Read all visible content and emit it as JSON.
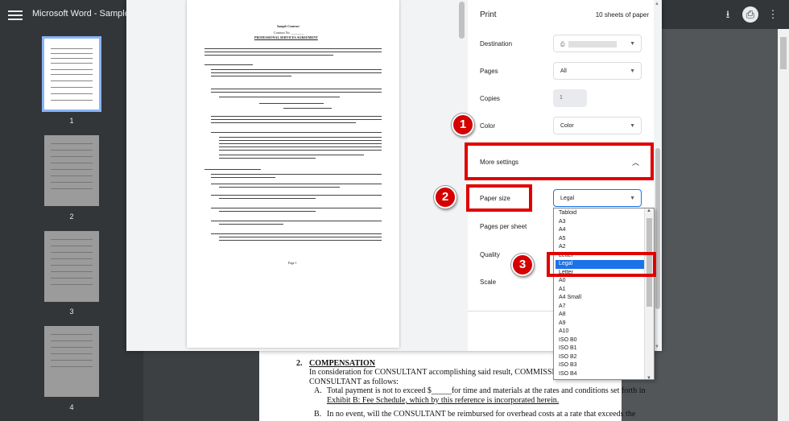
{
  "topbar": {
    "title": "Microsoft Word - SampleCont",
    "download_icon": "download-icon",
    "print_icon": "print-icon",
    "more_icon": "more-vert-icon"
  },
  "thumbnails": [
    {
      "page": "1"
    },
    {
      "page": "2"
    },
    {
      "page": "3"
    },
    {
      "page": "4"
    }
  ],
  "preview_text": {
    "title": "Sample Contract",
    "contract_no": "Contract No. ________",
    "heading": "PROFESSIONAL SERVICES AGREEMENT",
    "footer": "Page 1"
  },
  "print": {
    "header": "Print",
    "sheets": "10 sheets of paper",
    "destination_label": "Destination",
    "pages_label": "Pages",
    "pages_value": "All",
    "copies_label": "Copies",
    "copies_value": "1",
    "color_label": "Color",
    "color_value": "Color",
    "more_settings_label": "More settings",
    "paper_size_label": "Paper size",
    "paper_size_value": "Legal",
    "pages_per_sheet_label": "Pages per sheet",
    "quality_label": "Quality",
    "scale_label": "Scale"
  },
  "paper_options": [
    "Tabloid",
    "A3",
    "A4",
    "A5",
    "A2",
    "Letter",
    "Legal",
    "Letter",
    "A0",
    "A1",
    "A4 Small",
    "A7",
    "A8",
    "A9",
    "A10",
    "ISO B0",
    "ISO B1",
    "ISO B2",
    "ISO B3",
    "ISO B4"
  ],
  "background_doc": {
    "line1_num": "2.",
    "line1_head": "COMPENSATION",
    "line2": "In consideration for CONSULTANT accomplishing said result, COMMISSION a",
    "line3": "CONSULTANT as follows:",
    "line4a": "A.",
    "line4b": "Total payment is not to exceed $_____for time and materials at the rates and conditions set forth in",
    "line5": "Exhibit B: Fee Schedule, which by this reference is incorporated herein.",
    "line6a": "B.",
    "line6b": "In no event, will the CONSULTANT be reimbursed for overhead costs at a rate that exceeds the"
  },
  "annotations": [
    "1",
    "2",
    "3"
  ],
  "colors": {
    "annotation_red": "#e00000",
    "highlight_blue": "#1a73e8"
  }
}
